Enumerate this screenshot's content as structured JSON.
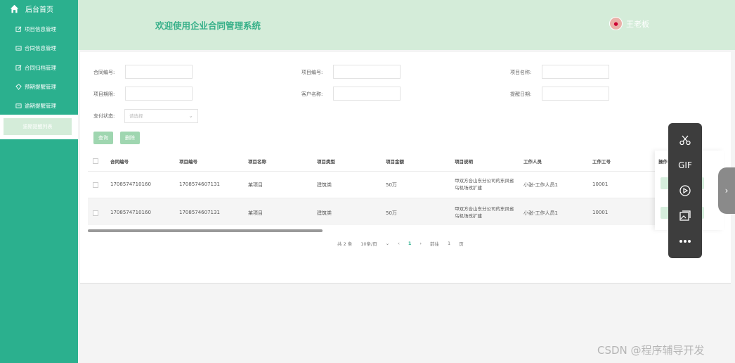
{
  "sidebar": {
    "home_label": "后台首页",
    "items": [
      {
        "label": "项目信息管理",
        "icon": "edit-icon"
      },
      {
        "label": "合同信息管理",
        "icon": "card-icon"
      },
      {
        "label": "合同归档管理",
        "icon": "edit-icon"
      },
      {
        "label": "预期提醒管理",
        "icon": "diamond-icon"
      },
      {
        "label": "逾期提醒管理",
        "icon": "card-icon"
      }
    ],
    "sub_item": "逾期提醒列表"
  },
  "header": {
    "title": "欢迎使用企业合同管理系统",
    "user_name": "王老板"
  },
  "filters": {
    "contract_no_label": "合同编号:",
    "project_no_label": "项目编号:",
    "project_name_label": "项目名称:",
    "project_period_label": "项目期限:",
    "customer_name_label": "客户名称:",
    "remind_date_label": "提醒日期:",
    "pay_status_label": "支付状态:",
    "pay_status_placeholder": "请选择",
    "query_button": "查询",
    "delete_button": "删除"
  },
  "table": {
    "columns": [
      "合同编号",
      "项目编号",
      "项目名称",
      "项目类型",
      "项目金额",
      "项目说明",
      "工作人员",
      "工作工号",
      "操作"
    ],
    "rows": [
      [
        "1708574710160",
        "1708574607131",
        "某项目",
        "建筑类",
        "50万",
        "甲双方合山东分公司的东风省乌机场改扩建",
        "小张-工作人员1",
        "10001"
      ],
      [
        "1708574710160",
        "1708574607131",
        "某项目",
        "建筑类",
        "50万",
        "甲双方合山东分公司的东风省乌机场改扩建",
        "小张-工作人员1",
        "10001"
      ]
    ]
  },
  "pagination": {
    "total": "共 2 条",
    "page_size": "10条/页",
    "current_page": "1",
    "goto_label": "前往",
    "goto_value": "1",
    "page_unit": "页"
  },
  "floating_toolbar": {
    "icons": [
      "scissors-icon",
      "gif-icon",
      "record-icon",
      "image-icon",
      "more-icon"
    ],
    "gif_label": "GIF"
  },
  "watermark": "CSDN @程序辅导开发"
}
